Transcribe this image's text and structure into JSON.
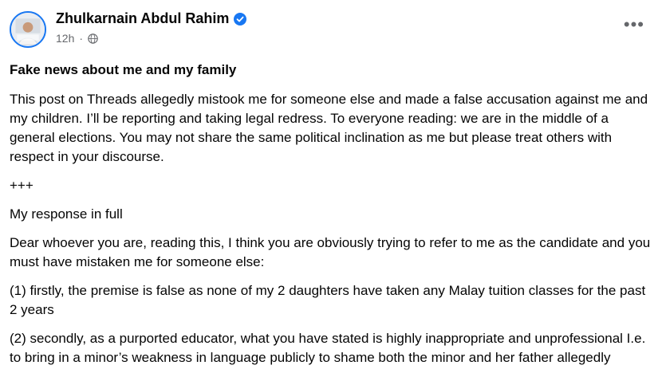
{
  "post": {
    "author": "Zhulkarnain Abdul Rahim",
    "timestamp": "12h",
    "more_label": "•••",
    "icons": {
      "avatar": "profile-photo",
      "verified": "verified-badge-icon",
      "audience": "globe-icon",
      "more": "more-options-icon"
    },
    "accent_color": "#1877f2",
    "title": "Fake news about me and my family",
    "paragraphs": [
      "This post on Threads allegedly mistook me for someone else and made a false accusation against me and my children. I’ll be reporting and taking legal redress. To everyone reading: we are in the middle of a general elections. You may not share the same political inclination as me but please treat others with respect in your discourse.",
      "+++",
      "My response in full",
      "Dear whoever you are, reading this, I think you are obviously trying to refer to me as the candidate and you must have mistaken me for someone else:",
      "(1) firstly, the premise is false as none of my 2 daughters have taken any Malay tuition classes for the past 2 years",
      "(2) secondly, as a purported educator, what you have stated is highly inappropriate and unprofessional I.e. to bring in a minor’s weakness in language publicly to shame both the minor and her father allegedly"
    ]
  }
}
